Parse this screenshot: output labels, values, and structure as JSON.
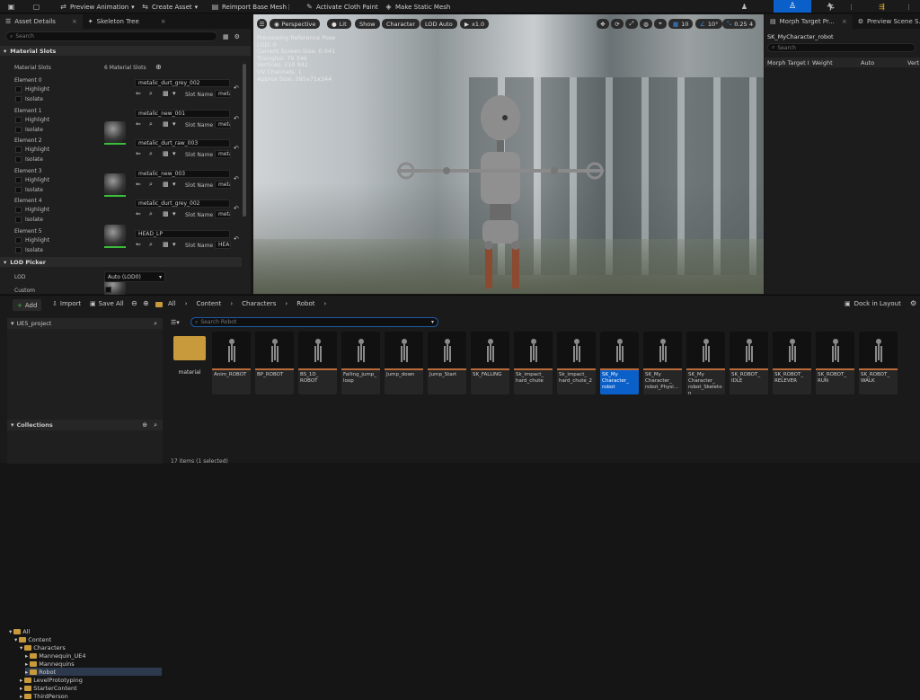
{
  "toolbar": {
    "preview_animation": "Preview Animation",
    "create_asset": "Create Asset",
    "reimport": "Reimport Base Mesh",
    "activate_cloth": "Activate Cloth Paint",
    "make_static": "Make Static Mesh"
  },
  "left_panel": {
    "tab_asset_details": "Asset Details",
    "tab_skeleton_tree": "Skeleton Tree",
    "search_placeholder": "Search",
    "material_slots_header": "Material Slots",
    "material_slots_label": "Material Slots",
    "material_slots_count": "6 Material Slots",
    "highlight_label": "Highlight",
    "isolate_label": "Isolate",
    "slot_name_label": "Slot Name",
    "elements": [
      {
        "label": "Element 0",
        "material": "metalic_durt_grey_002",
        "slot": "meta"
      },
      {
        "label": "Element 1",
        "material": "metalic_new_001",
        "slot": "meta"
      },
      {
        "label": "Element 2",
        "material": "metalic_durt_raw_003",
        "slot": "meta"
      },
      {
        "label": "Element 3",
        "material": "metalic_new_003",
        "slot": "meta"
      },
      {
        "label": "Element 4",
        "material": "metalic_durt_grey_002",
        "slot": "meta"
      },
      {
        "label": "Element 5",
        "material": "HEAD_LP",
        "slot": "HEAD"
      }
    ],
    "lod_picker_header": "LOD Picker",
    "lod_label": "LOD",
    "lod_value": "Auto (LOD0)",
    "custom_label": "Custom"
  },
  "viewport": {
    "perspective": "Perspective",
    "lit": "Lit",
    "show": "Show",
    "character": "Character",
    "lod_auto": "LOD Auto",
    "play_speed": "x1.0",
    "grid_value": "10",
    "angle_value": "10°",
    "scale_value": "0.25",
    "camera_speed": "4",
    "stats": [
      "Previewing Reference Pose",
      "LOD: 0",
      "Current Screen Size: 0.041",
      "Triangles: 79 346",
      "Vertices: 210 942",
      "UV Channels: 1",
      "Approx Size: 295x71x344"
    ]
  },
  "right_panel": {
    "tab_morph": "Morph Target Pr...",
    "tab_preview": "Preview Scene S...",
    "asset_name": "SK_MyCharacter_robot",
    "search_placeholder": "Search",
    "col_morph": "Morph Target I",
    "col_weight": "Weight",
    "col_auto": "Auto",
    "col_vert": "Vert"
  },
  "content_browser": {
    "add": "Add",
    "import": "Import",
    "save_all": "Save All",
    "crumbs": [
      "All",
      "Content",
      "Characters",
      "Robot"
    ],
    "dock": "Dock in Layout",
    "project": "UE5_project",
    "search_placeholder": "Search Robot",
    "tree": [
      "All",
      "Content",
      "Characters",
      "Mannequin_UE4",
      "Mannequins",
      "Robot",
      "LevelPrototyping",
      "StarterContent",
      "ThirdPerson"
    ],
    "collections": "Collections",
    "status": "17 items (1 selected)",
    "assets": [
      "material",
      "Anim_ROBOT",
      "BP_ROBOT",
      "BS_1D_ ROBOT",
      "Falling_jump_ loop",
      "Jump_down",
      "Jump_Start",
      "SK_FALLING",
      "Sk_impact_ hard_chute",
      "Sk_impact_ hard_chute_2",
      "SK_My Character_ robot",
      "SK_My Character_ robot_Physi...",
      "SK_My Character_ robot_Skeleton",
      "SK_ROBOT_ IDLE",
      "SK_ROBOT_ RELEVER",
      "SK_ROBOT_ RUN",
      "SK_ROBOT_ WALK"
    ]
  },
  "colors": {
    "selected": "#0a60c8",
    "accent_green": "#3bbf3b",
    "folder": "#c99a3b"
  }
}
